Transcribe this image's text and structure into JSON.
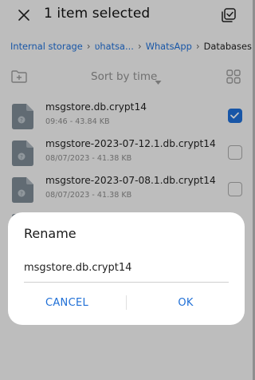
{
  "header": {
    "title": "1 item selected",
    "close_icon": "close-icon",
    "select_all_icon": "select-all-icon"
  },
  "breadcrumb": {
    "items": [
      {
        "label": "Internal storage",
        "link": true
      },
      {
        "label": "ʋhatsa...",
        "link": true
      },
      {
        "label": "WhatsApp",
        "link": true
      },
      {
        "label": "Databases",
        "link": false
      }
    ]
  },
  "toolbar": {
    "new_folder_icon": "new-folder-icon",
    "sort_label": "Sort by time",
    "grid_view_icon": "grid-view-icon"
  },
  "files": [
    {
      "name": "msgstore.db.crypt14",
      "meta": "09:46 - 43.84 KB",
      "checked": true
    },
    {
      "name": "msgstore-2023-07-12.1.db.crypt14",
      "meta": "08/07/2023 - 41.38 KB",
      "checked": false
    },
    {
      "name": "msgstore-2023-07-08.1.db.crypt14",
      "meta": "08/07/2023 - 41.38 KB",
      "checked": false
    }
  ],
  "dialog": {
    "title": "Rename",
    "input_value": "msgstore.db.crypt14",
    "cancel_label": "CANCEL",
    "ok_label": "OK"
  },
  "colors": {
    "accent": "#1f6fd6",
    "background": "#f3f3f3",
    "file_icon": "#7d8a94"
  }
}
